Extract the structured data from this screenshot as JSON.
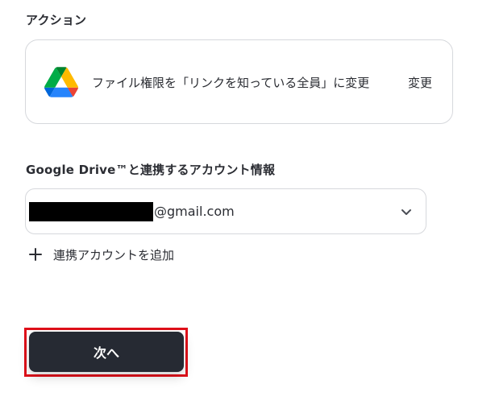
{
  "action": {
    "section_label": "アクション",
    "description": "ファイル権限を「リンクを知っている全員」に変更",
    "change_label": "変更",
    "icon": "google-drive-icon"
  },
  "account": {
    "section_label": "Google Drive™と連携するアカウント情報",
    "email_suffix": "@gmail.com",
    "add_account_label": "連携アカウントを追加"
  },
  "footer": {
    "next_label": "次へ"
  },
  "colors": {
    "button_bg": "#262a33",
    "highlight_border": "#e0101a",
    "border": "#d6d8dc",
    "text": "#2b2d33"
  }
}
